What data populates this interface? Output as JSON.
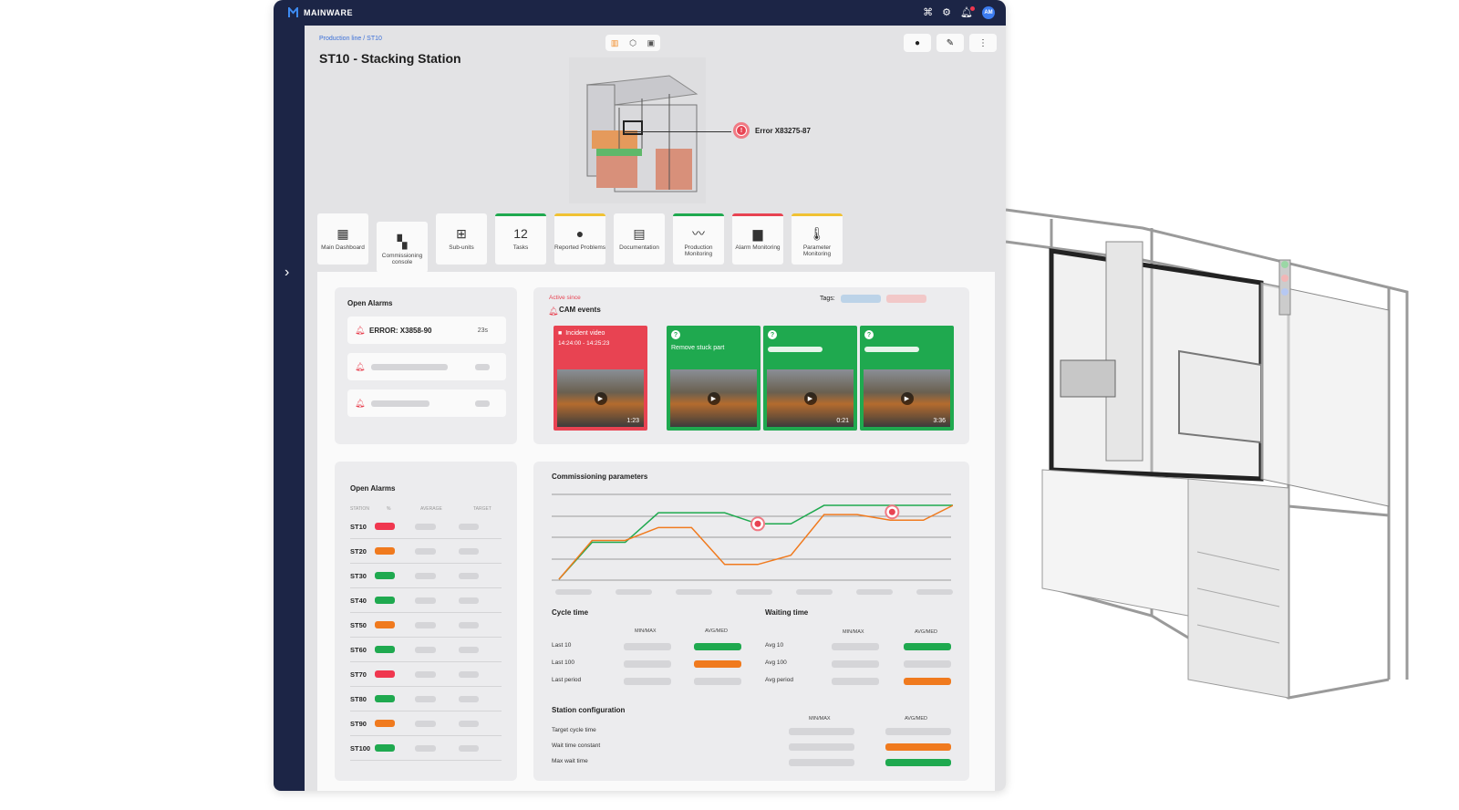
{
  "app": {
    "name": "MAINWARE"
  },
  "header": {
    "avatar_initials": "AM"
  },
  "breadcrumb": {
    "parent": "Production line",
    "separator": " / ",
    "current": "ST10"
  },
  "page": {
    "title": "ST10 - Stacking Station"
  },
  "error_callout": {
    "label": "Error X83275-87"
  },
  "tabs": [
    {
      "label": "Main Dashboard",
      "icon": "dashboard-icon"
    },
    {
      "label": "Commissioning console",
      "icon": "console-icon"
    },
    {
      "label": "Sub-units",
      "icon": "hierarchy-icon"
    },
    {
      "label": "Tasks",
      "number": "12",
      "status": "#1fa94f"
    },
    {
      "label": "Reported Problems",
      "icon": "alert-circle-icon",
      "status": "#f0c233"
    },
    {
      "label": "Documentation",
      "icon": "document-icon"
    },
    {
      "label": "Production Monitoring",
      "icon": "trend-icon",
      "status": "#1fa94f"
    },
    {
      "label": "Alarm Monitoring",
      "icon": "alert-message-icon",
      "status": "#e84352"
    },
    {
      "label": "Parameter Monitoring",
      "icon": "thermometer-icon",
      "status": "#f0c233"
    }
  ],
  "open_alarms": {
    "title": "Open Alarms",
    "first": {
      "text": "ERROR: X3858-90",
      "time": "23s"
    }
  },
  "cam_events": {
    "active_since": "Active since",
    "title": "CAM events",
    "tags_label": "Tags:",
    "tiles": [
      {
        "title": "Incident video",
        "subtitle": "14:24:00 - 14:25:23",
        "duration": "1:23",
        "color": "#e84352"
      },
      {
        "title": "Remove stuck part",
        "duration": "",
        "color": "#1fa94f"
      },
      {
        "duration": "0:21",
        "color": "#1fa94f"
      },
      {
        "duration": "3:36",
        "color": "#1fa94f"
      }
    ]
  },
  "station_alarms": {
    "title": "Open Alarms",
    "columns": [
      "STATION",
      "%",
      "AVERAGE",
      "TARGET"
    ],
    "rows": [
      {
        "name": "ST10",
        "status": "#f0374f"
      },
      {
        "name": "ST20",
        "status": "#f07a1e"
      },
      {
        "name": "ST30",
        "status": "#1fa94f"
      },
      {
        "name": "ST40",
        "status": "#1fa94f"
      },
      {
        "name": "ST50",
        "status": "#f07a1e"
      },
      {
        "name": "ST60",
        "status": "#1fa94f"
      },
      {
        "name": "ST70",
        "status": "#f0374f"
      },
      {
        "name": "ST80",
        "status": "#1fa94f"
      },
      {
        "name": "ST90",
        "status": "#f07a1e"
      },
      {
        "name": "ST100",
        "status": "#1fa94f"
      }
    ]
  },
  "commissioning": {
    "title": "Commissioning parameters",
    "cycle_time": {
      "title": "Cycle time",
      "columns": [
        "MIN/MAX",
        "AVG/MED"
      ],
      "rows": [
        {
          "label": "Last 10",
          "status": "green"
        },
        {
          "label": "Last 100",
          "status": "orange"
        },
        {
          "label": "Last period",
          "status": "gray"
        }
      ]
    },
    "waiting_time": {
      "title": "Waiting time",
      "columns": [
        "MIN/MAX",
        "AVG/MED"
      ],
      "rows": [
        {
          "label": "Avg 10",
          "status": "green"
        },
        {
          "label": "Avg 100",
          "status": "gray"
        },
        {
          "label": "Avg period",
          "status": "orange"
        }
      ]
    },
    "station_config": {
      "title": "Station configuration",
      "columns": [
        "MIN/MAX",
        "AVG/MED"
      ],
      "rows": [
        {
          "label": "Target cycle time",
          "status": "gray"
        },
        {
          "label": "Wait time constant",
          "status": "orange"
        },
        {
          "label": "Max wait time",
          "status": "green"
        }
      ]
    }
  },
  "chart_data": {
    "type": "line",
    "title": "Commissioning parameters",
    "x": [
      0,
      1,
      2,
      3,
      4,
      5,
      6,
      7,
      8,
      9,
      10,
      11,
      12
    ],
    "series": [
      {
        "color": "#1fa94f",
        "values": [
          0,
          2,
          2,
          3.6,
          3.6,
          3.6,
          3,
          3,
          4,
          4,
          4,
          4,
          4
        ]
      },
      {
        "color": "#f07a1e",
        "values": [
          0,
          2.1,
          2.1,
          2.8,
          2.8,
          0.8,
          0.8,
          1.3,
          3.5,
          3.5,
          3.2,
          3.2,
          4.1
        ]
      }
    ],
    "colors": {
      "green": "#1fa94f",
      "orange": "#f07a1e"
    }
  }
}
